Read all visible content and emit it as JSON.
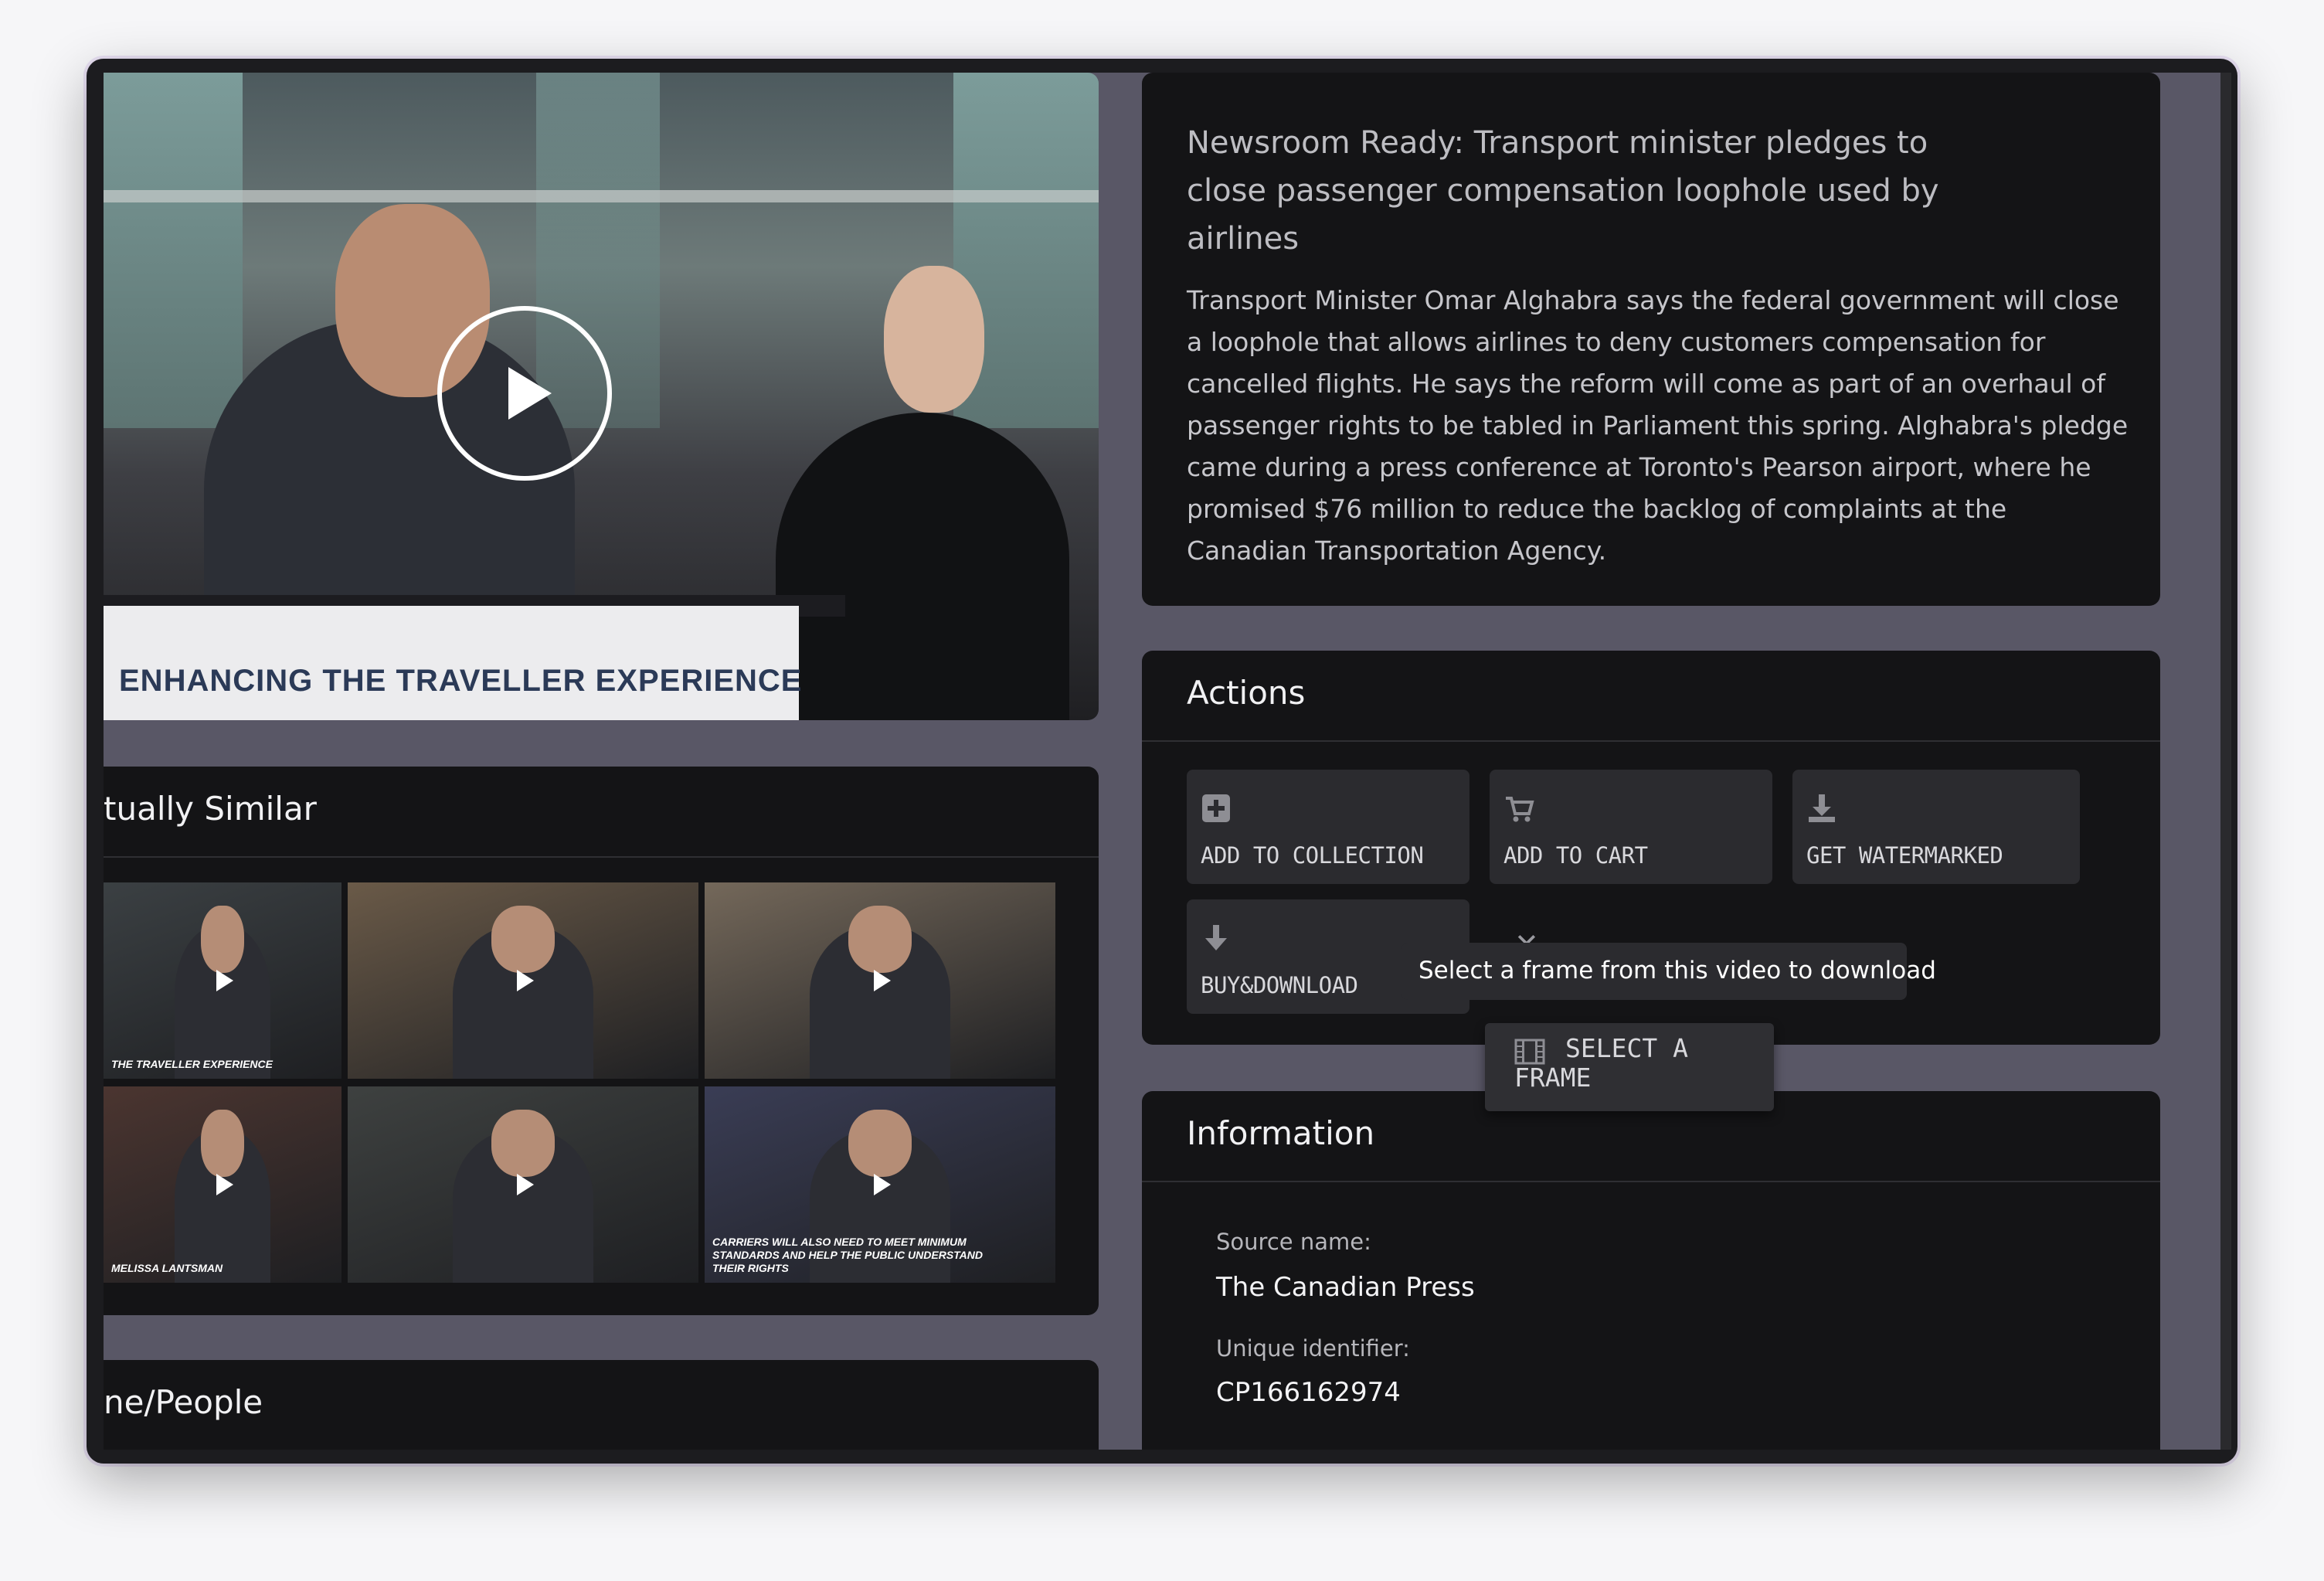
{
  "video": {
    "overlay_text": "ENHANCING THE TRAVELLER EXPERIENCE"
  },
  "description": {
    "title": "Newsroom Ready: Transport minister pledges to close passenger compensation loophole used by airlines",
    "body": "Transport Minister Omar Alghabra says the federal government will close a loophole that allows airlines to deny customers compensation for cancelled flights. He says the reform will come as part of an overhaul of passenger rights to be tabled in Parliament this spring. Alghabra's pledge came during a press conference at Toronto's Pearson airport, where he promised $76 million to reduce the backlog of complaints at the Canadian Transportation Agency."
  },
  "actions": {
    "heading": "Actions",
    "add_to_collection": "ADD TO COLLECTION",
    "add_to_cart": "ADD TO CART",
    "get_watermarked": "GET WATERMARKED",
    "buy_download": "BUY&DOWNLOAD",
    "tooltip": "Select a frame from this video to download",
    "select_frame": "SELECT A FRAME"
  },
  "information": {
    "heading": "Information",
    "source_label": "Source name:",
    "source_value": "The Canadian Press",
    "uid_label": "Unique identifier:",
    "uid_value": "CP166162974"
  },
  "similar": {
    "heading": "tually Similar",
    "thumbs": [
      {
        "caption": "THE TRAVELLER EXPERIENCE",
        "bg": "#3b4043"
      },
      {
        "caption": "",
        "bg": "#6a5a48"
      },
      {
        "caption": "",
        "bg": "#74685a"
      },
      {
        "caption": "MELISSA LANTSMAN",
        "bg": "#4b3530"
      },
      {
        "caption": "",
        "bg": "#3e4140"
      },
      {
        "caption": "CARRIERS WILL ALSO NEED TO MEET MINIMUM STANDARDS AND HELP THE PUBLIC UNDERSTAND THEIR RIGHTS",
        "bg": "#3a3d55"
      }
    ]
  },
  "people": {
    "heading": "ne/People"
  },
  "colors": {
    "panel": "#141416",
    "backdrop": "#595766",
    "button": "#2b2b2f"
  }
}
